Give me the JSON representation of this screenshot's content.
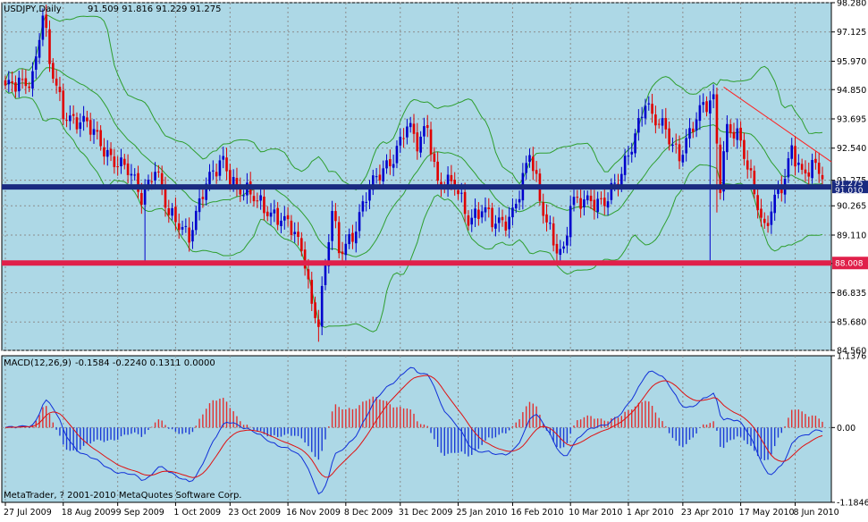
{
  "colors": {
    "background": "#add8e6",
    "grid": "#8c8c8c",
    "bull": "#0000cc",
    "bear": "#e00000",
    "bands": "#2e9e2e",
    "support": "#e0204a",
    "resistance": "#1a2a80",
    "trendline": "#ff2020",
    "macd_up": "#e03030",
    "macd_down": "#1a3ad6",
    "macd_line": "#1030d8",
    "signal_line": "#e01010",
    "price_label_bg": "#1a2a80",
    "support_label_bg": "#e0204a"
  },
  "chart_data": [
    {
      "type": "candlestick",
      "title": "USDJPY,Daily",
      "ohlc_header": "91.509 91.816 91.229 91.275",
      "indicator": "bollinger-bands",
      "ylim": [
        84.56,
        98.28
      ],
      "y_ticks": [
        "98.280",
        "97.125",
        "95.970",
        "94.850",
        "93.695",
        "92.540",
        "91.275",
        "90.265",
        "89.110",
        "87.990",
        "86.835",
        "85.680",
        "84.560"
      ],
      "x_ticks": [
        "27 Jul 2009",
        "18 Aug 2009",
        "9 Sep 2009",
        "1 Oct 2009",
        "23 Oct 2009",
        "16 Nov 2009",
        "8 Dec 2009",
        "31 Dec 2009",
        "25 Jan 2010",
        "16 Feb 2010",
        "10 Mar 2010",
        "1 Apr 2010",
        "23 Apr 2010",
        "17 May 2010",
        "8 Jun 2010"
      ],
      "current_price": "91.275",
      "horizontal_lines": [
        {
          "value": 91.01,
          "label": "91.010"
        },
        {
          "value": 88.008,
          "label": "88.008"
        }
      ],
      "trendline": {
        "from": {
          "date": "23 Apr 2010",
          "value": 94.95
        },
        "to": {
          "date": "10 Jun 2010",
          "value": 92.0
        }
      },
      "anchors": [
        {
          "i": 0,
          "c": 94.8
        },
        {
          "i": 8,
          "c": 95.4
        },
        {
          "i": 11,
          "c": 97.8
        },
        {
          "i": 13,
          "c": 95.8
        },
        {
          "i": 17,
          "c": 94.0
        },
        {
          "i": 24,
          "c": 93.4
        },
        {
          "i": 30,
          "c": 92.4
        },
        {
          "i": 36,
          "c": 91.6
        },
        {
          "i": 40,
          "c": 90.6
        },
        {
          "i": 44,
          "c": 91.9
        },
        {
          "i": 48,
          "c": 89.8
        },
        {
          "i": 54,
          "c": 89.2
        },
        {
          "i": 58,
          "c": 90.8
        },
        {
          "i": 64,
          "c": 92.1
        },
        {
          "i": 68,
          "c": 91.0
        },
        {
          "i": 74,
          "c": 90.4
        },
        {
          "i": 80,
          "c": 89.9
        },
        {
          "i": 84,
          "c": 89.3
        },
        {
          "i": 88,
          "c": 88.2
        },
        {
          "i": 90,
          "c": 86.4
        },
        {
          "i": 92,
          "c": 85.8
        },
        {
          "i": 94,
          "c": 87.8
        },
        {
          "i": 96,
          "c": 90.0
        },
        {
          "i": 98,
          "c": 88.4
        },
        {
          "i": 102,
          "c": 89.2
        },
        {
          "i": 106,
          "c": 90.6
        },
        {
          "i": 110,
          "c": 91.5
        },
        {
          "i": 114,
          "c": 92.3
        },
        {
          "i": 118,
          "c": 93.4
        },
        {
          "i": 121,
          "c": 92.6
        },
        {
          "i": 124,
          "c": 93.5
        },
        {
          "i": 127,
          "c": 91.2
        },
        {
          "i": 132,
          "c": 91.0
        },
        {
          "i": 136,
          "c": 89.8
        },
        {
          "i": 140,
          "c": 90.2
        },
        {
          "i": 144,
          "c": 89.4
        },
        {
          "i": 148,
          "c": 89.8
        },
        {
          "i": 152,
          "c": 91.3
        },
        {
          "i": 154,
          "c": 92.3
        },
        {
          "i": 157,
          "c": 90.4
        },
        {
          "i": 162,
          "c": 88.7
        },
        {
          "i": 164,
          "c": 88.4
        },
        {
          "i": 166,
          "c": 90.2
        },
        {
          "i": 172,
          "c": 90.6
        },
        {
          "i": 176,
          "c": 90.4
        },
        {
          "i": 180,
          "c": 91.1
        },
        {
          "i": 184,
          "c": 92.8
        },
        {
          "i": 188,
          "c": 94.4
        },
        {
          "i": 190,
          "c": 93.6
        },
        {
          "i": 194,
          "c": 93.3
        },
        {
          "i": 198,
          "c": 92.3
        },
        {
          "i": 201,
          "c": 93.0
        },
        {
          "i": 205,
          "c": 94.2
        },
        {
          "i": 208,
          "c": 94.6
        },
        {
          "i": 210,
          "c": 91.2
        },
        {
          "i": 212,
          "c": 93.3
        },
        {
          "i": 216,
          "c": 92.7
        },
        {
          "i": 220,
          "c": 91.0
        },
        {
          "i": 223,
          "c": 89.3
        },
        {
          "i": 226,
          "c": 90.4
        },
        {
          "i": 229,
          "c": 91.3
        },
        {
          "i": 231,
          "c": 92.7
        },
        {
          "i": 234,
          "c": 91.6
        },
        {
          "i": 238,
          "c": 91.7
        },
        {
          "i": 240,
          "c": 91.4
        }
      ],
      "spikes": [
        {
          "i": 41,
          "l": 88.1
        },
        {
          "i": 92,
          "l": 84.9
        },
        {
          "i": 207,
          "l": 88.1
        },
        {
          "i": 209,
          "l": 90.0
        }
      ]
    },
    {
      "type": "macd",
      "title": "MACD(12,26,9)",
      "values_header": "-0.1584 -0.2240 0.1311 0.0000",
      "ylim": [
        -1.1846,
        1.1376
      ],
      "y_ticks": [
        "1.1376",
        "0.00",
        "-1.1846"
      ],
      "footer": "MetaTrader, ? 2001-2010 MetaQuotes Software Corp."
    }
  ]
}
